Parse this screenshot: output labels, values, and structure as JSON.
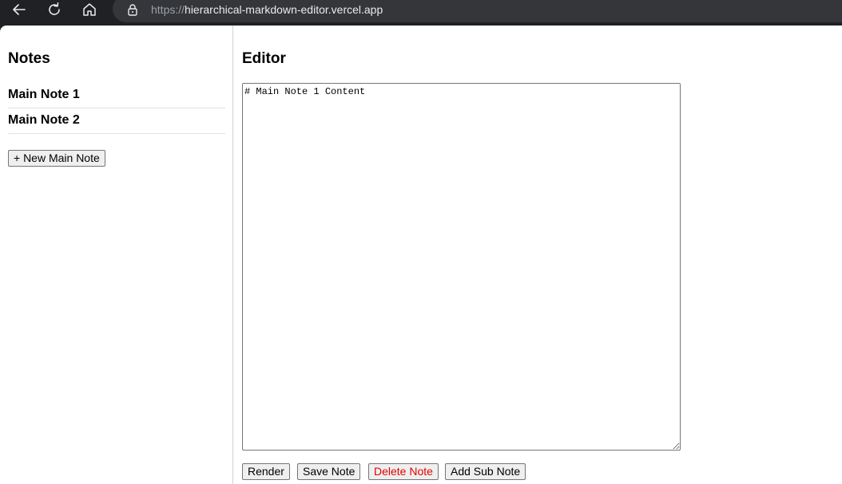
{
  "browser": {
    "url_scheme": "https://",
    "url_host": "hierarchical-markdown-editor.vercel.app"
  },
  "sidebar": {
    "title": "Notes",
    "notes": [
      {
        "label": "Main Note 1"
      },
      {
        "label": "Main Note 2"
      }
    ],
    "new_note_label": "+ New Main Note"
  },
  "editor": {
    "title": "Editor",
    "content": "# Main Note 1 Content",
    "buttons": {
      "render": "Render",
      "save": "Save Note",
      "delete": "Delete Note",
      "add_sub": "Add Sub Note"
    }
  },
  "colors": {
    "delete_text": "#e60000",
    "chrome_bg": "#202124",
    "urlbar_bg": "#35363a"
  }
}
